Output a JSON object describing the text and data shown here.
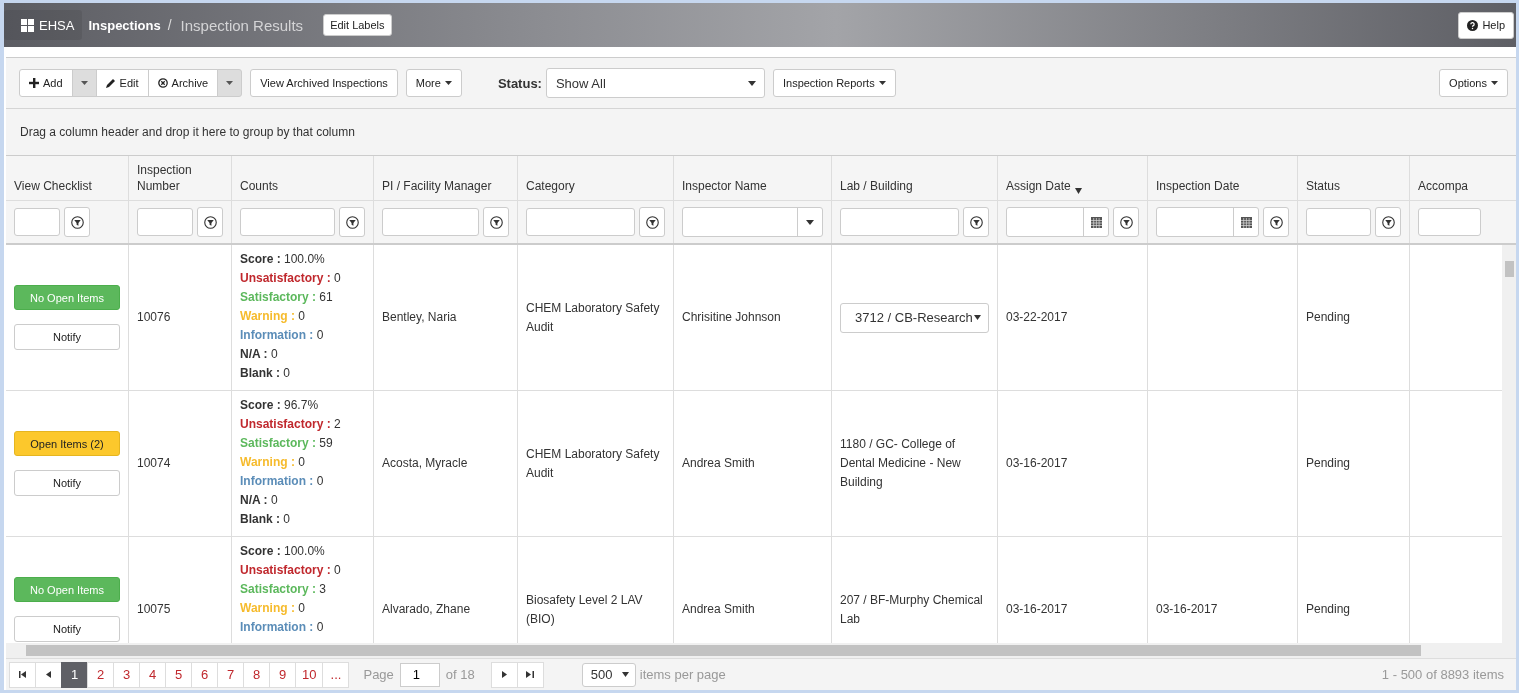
{
  "header": {
    "brand": "EHSA",
    "breadcrumb": [
      {
        "label": "Inspections",
        "kind": "link"
      },
      {
        "label": "/",
        "kind": "separator"
      },
      {
        "label": "Inspection Results",
        "kind": "current"
      }
    ],
    "edit_labels": "Edit Labels",
    "help": "Help"
  },
  "toolbar": {
    "add": "Add",
    "edit": "Edit",
    "archive": "Archive",
    "view_archived": "View Archived Inspections",
    "more": "More",
    "status_label": "Status:",
    "status_value": "Show All",
    "reports": "Inspection Reports",
    "options": "Options"
  },
  "group_hint": "Drag a column header and drop it here to group by that column",
  "columns": [
    {
      "label": "View Checklist",
      "sorted": false,
      "filter": {
        "kind": "text"
      }
    },
    {
      "label": "Inspection Number",
      "sorted": false,
      "filter": {
        "kind": "text"
      }
    },
    {
      "label": "Counts",
      "sorted": false,
      "filter": {
        "kind": "text"
      }
    },
    {
      "label": "PI / Facility Manager",
      "sorted": false,
      "filter": {
        "kind": "text"
      }
    },
    {
      "label": "Category",
      "sorted": false,
      "filter": {
        "kind": "text"
      }
    },
    {
      "label": "Inspector Name",
      "sorted": false,
      "filter": {
        "kind": "dropdown"
      }
    },
    {
      "label": "Lab / Building",
      "sorted": false,
      "filter": {
        "kind": "text"
      }
    },
    {
      "label": "Assign Date",
      "sorted": true,
      "filter": {
        "kind": "date"
      }
    },
    {
      "label": "Inspection Date",
      "sorted": false,
      "filter": {
        "kind": "date"
      }
    },
    {
      "label": "Status",
      "sorted": false,
      "filter": {
        "kind": "text"
      }
    },
    {
      "label": "Accompa",
      "sorted": false,
      "filter": {
        "kind": "text"
      }
    }
  ],
  "rows": [
    {
      "checklist": {
        "label": "No Open Items",
        "kind": "clear"
      },
      "notify": "Notify",
      "number": "10076",
      "counts": [
        {
          "kind": "score",
          "label": "Score :",
          "value": "100.0%"
        },
        {
          "kind": "unsatisfactory",
          "label": "Unsatisfactory :",
          "value": "0"
        },
        {
          "kind": "satisfactory",
          "label": "Satisfactory :",
          "value": "61"
        },
        {
          "kind": "warning",
          "label": "Warning :",
          "value": "0"
        },
        {
          "kind": "information",
          "label": "Information :",
          "value": "0"
        },
        {
          "kind": "na",
          "label": "N/A :",
          "value": "0"
        },
        {
          "kind": "blank",
          "label": "Blank :",
          "value": "0"
        }
      ],
      "manager": "Bentley, Naria",
      "category": "CHEM Laboratory Safety Audit",
      "inspector": "Chrisitine Johnson",
      "lab": {
        "kind": "select",
        "text": "3712 / CB-Research"
      },
      "assign_date": "03-22-2017",
      "status": "Pending"
    },
    {
      "checklist": {
        "label": "Open Items (2)",
        "kind": "open"
      },
      "notify": "Notify",
      "number": "10074",
      "counts": [
        {
          "kind": "score",
          "label": "Score :",
          "value": "96.7%"
        },
        {
          "kind": "unsatisfactory",
          "label": "Unsatisfactory :",
          "value": "2"
        },
        {
          "kind": "satisfactory",
          "label": "Satisfactory :",
          "value": "59"
        },
        {
          "kind": "warning",
          "label": "Warning :",
          "value": "0"
        },
        {
          "kind": "information",
          "label": "Information :",
          "value": "0"
        },
        {
          "kind": "na",
          "label": "N/A :",
          "value": "0"
        },
        {
          "kind": "blank",
          "label": "Blank :",
          "value": "0"
        }
      ],
      "manager": "Acosta, Myracle",
      "category": "CHEM Laboratory Safety Audit",
      "inspector": "Andrea Smith",
      "lab": {
        "kind": "text",
        "text": "1180 / GC- College of Dental Medicine - New Building"
      },
      "assign_date": "03-16-2017",
      "status": "Pending"
    },
    {
      "checklist": {
        "label": "No Open Items",
        "kind": "clear"
      },
      "notify": "Notify",
      "number": "10075",
      "counts": [
        {
          "kind": "score",
          "label": "Score :",
          "value": "100.0%"
        },
        {
          "kind": "unsatisfactory",
          "label": "Unsatisfactory :",
          "value": "0"
        },
        {
          "kind": "satisfactory",
          "label": "Satisfactory :",
          "value": "3"
        },
        {
          "kind": "warning",
          "label": "Warning :",
          "value": "0"
        },
        {
          "kind": "information",
          "label": "Information :",
          "value": "0"
        }
      ],
      "manager": "Alvarado, Zhane",
      "category": "Biosafety Level 2 LAV (BIO)",
      "inspector": "Andrea Smith",
      "lab": {
        "kind": "text",
        "text": "207 / BF-Murphy Chemical Lab"
      },
      "assign_date": "03-16-2017",
      "inspection_date": "03-16-2017",
      "status": "Pending"
    }
  ],
  "pager": {
    "pages": [
      {
        "label": "1",
        "selected": true
      },
      {
        "label": "2",
        "selected": false
      },
      {
        "label": "3",
        "selected": false
      },
      {
        "label": "4",
        "selected": false
      },
      {
        "label": "5",
        "selected": false
      },
      {
        "label": "6",
        "selected": false
      },
      {
        "label": "7",
        "selected": false
      },
      {
        "label": "8",
        "selected": false
      },
      {
        "label": "9",
        "selected": false
      },
      {
        "label": "10",
        "selected": false
      },
      {
        "label": "...",
        "selected": false
      }
    ],
    "page_label": "Page",
    "page_value": "1",
    "of_label": "of 18",
    "page_size": "500",
    "per_page_label": "items per page",
    "summary": "1 - 500 of 8893 items"
  }
}
